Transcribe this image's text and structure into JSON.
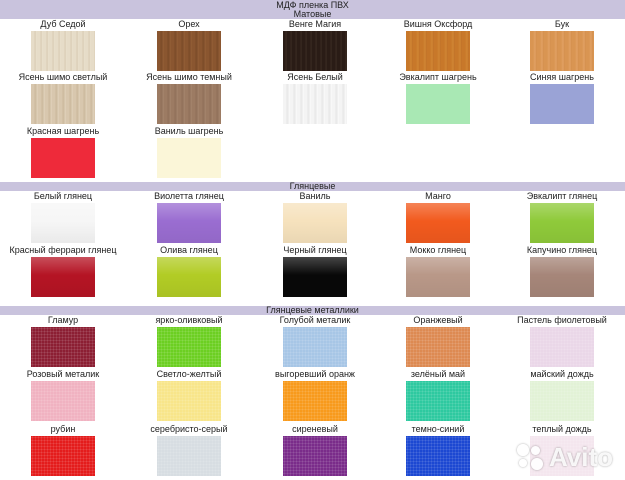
{
  "colors": {
    "section_bar": "#c9c3dd"
  },
  "header": {
    "title": "МДФ пленка ПВХ"
  },
  "sections": [
    {
      "title": "Матовые",
      "items": [
        {
          "label": "Дуб Седой",
          "color": "#e6dcc8",
          "texture": "wood1"
        },
        {
          "label": "Орех",
          "color": "#8a5630",
          "texture": "walnut"
        },
        {
          "label": "Венге Магия",
          "color": "#2a1c16",
          "texture": "wenge"
        },
        {
          "label": "Вишня Оксфорд",
          "color": "#c8782a",
          "texture": "cherry"
        },
        {
          "label": "Бук",
          "color": "#d99552",
          "texture": "beech"
        },
        {
          "label": "Ясень шимо светлый",
          "color": "#d8c7ae",
          "texture": "ash1"
        },
        {
          "label": "Ясень шимо темный",
          "color": "#9c7b63",
          "texture": "ash2"
        },
        {
          "label": "Ясень Белый",
          "color": "#f4f4f4",
          "texture": "ash3"
        },
        {
          "label": "Эвкалипт шагрень",
          "color": "#a9e8b4",
          "texture": "flat"
        },
        {
          "label": "Синяя шагрень",
          "color": "#9aa3d6",
          "texture": "flat"
        },
        {
          "label": "Красная шагрень",
          "color": "#ee2a3a",
          "texture": "flat"
        },
        {
          "label": "Ваниль шагрень",
          "color": "#fbf6d8",
          "texture": "flat"
        }
      ]
    },
    {
      "title": "Глянцевые",
      "items": [
        {
          "label": "Белый глянец",
          "color": "#f6f6f6",
          "texture": "gloss"
        },
        {
          "label": "Виолетта глянец",
          "color": "#9a6dd1",
          "texture": "gloss"
        },
        {
          "label": "Ваниль",
          "color": "#f6e2bd",
          "texture": "gloss"
        },
        {
          "label": "Манго",
          "color": "#f25a1e",
          "texture": "gloss"
        },
        {
          "label": "Эвкалипт глянец",
          "color": "#8fca3a",
          "texture": "gloss"
        },
        {
          "label": "Красный феррари глянец",
          "color": "#b51424",
          "texture": "gloss"
        },
        {
          "label": "Олива глянец",
          "color": "#b2cc25",
          "texture": "gloss"
        },
        {
          "label": "Черный глянец",
          "color": "#080808",
          "texture": "gloss"
        },
        {
          "label": "Мокко глянец",
          "color": "#b99888",
          "texture": "gloss"
        },
        {
          "label": "Капучино глянец",
          "color": "#a68679",
          "texture": "gloss"
        }
      ]
    },
    {
      "title": "Глянцевые металлики",
      "items": [
        {
          "label": "Гламур",
          "color": "#8c1f33",
          "texture": "metal"
        },
        {
          "label": "ярко-оливковый",
          "color": "#6ccf22",
          "texture": "metal"
        },
        {
          "label": "Голубой металик",
          "color": "#a7c6e6",
          "texture": "metal"
        },
        {
          "label": "Оранжевый",
          "color": "#dd8a52",
          "texture": "metal"
        },
        {
          "label": "Пастель фиолетовый",
          "color": "#ead7e8",
          "texture": "metal"
        },
        {
          "label": "Розовый металик",
          "color": "#f0b2c1",
          "texture": "metal"
        },
        {
          "label": "Светло-желтый",
          "color": "#f8e58a",
          "texture": "metal"
        },
        {
          "label": "выгоревший оранж",
          "color": "#f89a1c",
          "texture": "metal"
        },
        {
          "label": "зелёный май",
          "color": "#2ec9a0",
          "texture": "metal"
        },
        {
          "label": "майский дождь",
          "color": "#e2f2d6",
          "texture": "metal"
        },
        {
          "label": "рубин",
          "color": "#e41c1c",
          "texture": "metal"
        },
        {
          "label": "серебристо-серый",
          "color": "#d7dde2",
          "texture": "metal"
        },
        {
          "label": "сиреневый",
          "color": "#7a2c8a",
          "texture": "metal"
        },
        {
          "label": "темно-синий",
          "color": "#1c48d2",
          "texture": "metal"
        },
        {
          "label": "теплый дождь",
          "color": "#f4e6ee",
          "texture": "metal"
        }
      ]
    }
  ],
  "watermark": {
    "text": "Avito"
  }
}
